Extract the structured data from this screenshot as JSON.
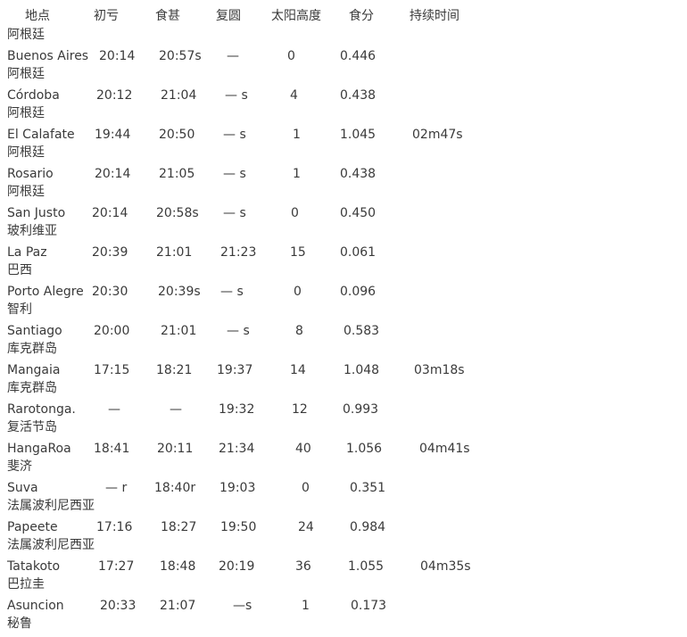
{
  "headers": [
    "地点",
    "初亏",
    "食甚",
    "复圆",
    "太阳高度",
    "食分",
    "持续时间"
  ],
  "first_country": "阿根廷",
  "rows": [
    {
      "name": "Buenos Aires",
      "c1": "20:14",
      "c2": "20:57s",
      "c3": "—",
      "alt": "0",
      "mag": "0.446",
      "dur": "",
      "next_country": "阿根廷"
    },
    {
      "name": "Córdoba",
      "c1": "20:12",
      "c2": "21:04",
      "c3": "— s",
      "alt": "4",
      "mag": "0.438",
      "dur": "",
      "next_country": "阿根廷"
    },
    {
      "name": "El Calafate",
      "c1": "19:44",
      "c2": "20:50",
      "c3": "— s",
      "alt": "1",
      "mag": "1.045",
      "dur": "02m47s",
      "next_country": "阿根廷"
    },
    {
      "name": "Rosario",
      "c1": "20:14",
      "c2": "21:05",
      "c3": "— s",
      "alt": "1",
      "mag": "0.438",
      "dur": "",
      "next_country": "阿根廷"
    },
    {
      "name": "San Justo",
      "c1": "20:14",
      "c2": "20:58s",
      "c3": "— s",
      "alt": "0",
      "mag": "0.450",
      "dur": "",
      "next_country": "玻利维亚"
    },
    {
      "name": "La Paz",
      "c1": "20:39",
      "c2": "21:01",
      "c3": "21:23",
      "alt": "15",
      "mag": "0.061",
      "dur": "",
      "next_country": "巴西"
    },
    {
      "name": "Porto Alegre",
      "c1": "20:30",
      "c2": "20:39s",
      "c3": "— s",
      "alt": "0",
      "mag": "0.096",
      "dur": "",
      "next_country": "智利"
    },
    {
      "name": "Santiago",
      "c1": "20:00",
      "c2": "21:01",
      "c3": "— s",
      "alt": "8",
      "mag": "0.583",
      "dur": "",
      "next_country": "库克群岛"
    },
    {
      "name": "Mangaia",
      "c1": "17:15",
      "c2": "18:21",
      "c3": "19:37",
      "alt": "14",
      "mag": "1.048",
      "dur": "03m18s",
      "next_country": "库克群岛"
    },
    {
      "name": "Rarotonga.",
      "c1": "—",
      "c2": "—",
      "c3": "19:32",
      "alt": "12",
      "mag": "0.993",
      "dur": "",
      "next_country": "复活节岛"
    },
    {
      "name": "HangaRoa",
      "c1": "18:41",
      "c2": "20:11",
      "c3": "21:34",
      "alt": "40",
      "mag": "1.056",
      "dur": "04m41s",
      "next_country": "斐济"
    },
    {
      "name": "Suva",
      "c1": "— r",
      "c2": "18:40r",
      "c3": "19:03",
      "alt": "0",
      "mag": "0.351",
      "dur": "",
      "next_country": "法属波利尼西亚"
    },
    {
      "name": "Papeete",
      "c1": "17:16",
      "c2": "18:27",
      "c3": "19:50",
      "alt": "24",
      "mag": "0.984",
      "dur": "",
      "next_country": "法属波利尼西亚"
    },
    {
      "name": "Tatakoto",
      "c1": "17:27",
      "c2": "18:48",
      "c3": "20:19",
      "alt": "36",
      "mag": "1.055",
      "dur": "04m35s",
      "next_country": "巴拉圭"
    },
    {
      "name": "Asuncion",
      "c1": "20:33",
      "c2": "21:07",
      "c3": "—s",
      "alt": "1",
      "mag": "0.173",
      "dur": "",
      "next_country": "秘鲁"
    }
  ]
}
